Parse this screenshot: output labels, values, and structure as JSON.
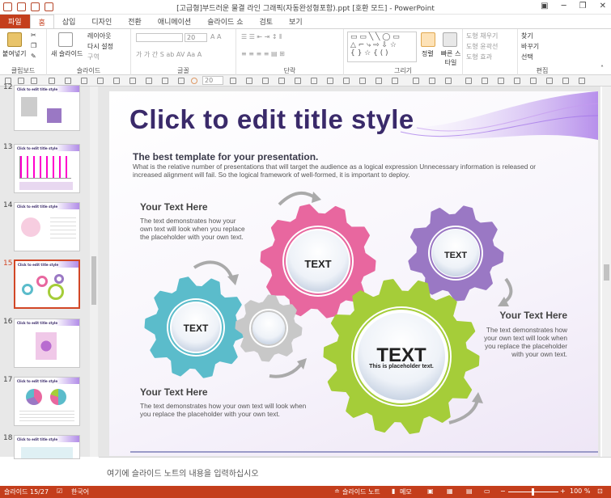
{
  "window": {
    "title": "[고급형]부드러운 물결 라인 그래픽(자동완성형포함).ppt [호환 모드] - PowerPoint"
  },
  "tabs": [
    "파일",
    "홈",
    "삽입",
    "디자인",
    "전환",
    "애니메이션",
    "슬라이드 쇼",
    "검토",
    "보기"
  ],
  "ribbon": {
    "paste": "붙여넣기",
    "clipboard": "클립보드",
    "new_slide": "새 슬라이드",
    "layout": "레이아웃",
    "reset": "다시 설정",
    "section": "구역",
    "slides": "슬라이드",
    "font_size": "20",
    "font": "글꼴",
    "paragraph": "단락",
    "arrange": "정렬",
    "quick_style": "빠른 스타일",
    "shape_fill": "도형 채우기",
    "shape_outline": "도형 윤곽선",
    "shape_effect": "도형 효과",
    "drawing": "그리기",
    "find": "찾기",
    "replace": "바꾸기",
    "select": "선택",
    "editing": "편집",
    "tb2_font_size": "20"
  },
  "thumbs": [
    {
      "num": "12",
      "title": "Click to edit title style"
    },
    {
      "num": "13",
      "title": "Click to edit title style"
    },
    {
      "num": "14",
      "title": "Click to edit title style"
    },
    {
      "num": "15",
      "title": "Click to edit title style"
    },
    {
      "num": "16",
      "title": "Click to edit title style"
    },
    {
      "num": "17",
      "title": "Click to edit title style"
    },
    {
      "num": "18",
      "title": "Click to edit title style"
    }
  ],
  "slide": {
    "title": "Click to edit title style",
    "subtitle": "The best template for your presentation.",
    "desc1": "What is the relative number of presentations that will target the audience as a logical expression Unnecessary information is released or",
    "desc2": "increased alignment will fail. So the logical framework of well-formed, it is important to deploy.",
    "b1_head": "Your Text Here",
    "b1_l1": "The text demonstrates how your",
    "b1_l2": "own text will look when you replace",
    "b1_l3": "the placeholder with your own text.",
    "b2_head": "Your Text Here",
    "b2_l1": "The text demonstrates how",
    "b2_l2": "your own text will look when",
    "b2_l3": "you replace the placeholder",
    "b2_l4": "with your own text.",
    "b3_head": "Your Text Here",
    "b3_l1": "The text demonstrates how your own text will look when",
    "b3_l2": "you replace the placeholder with your own text.",
    "gear_pink": "TEXT",
    "gear_purple": "TEXT",
    "gear_teal": "TEXT",
    "gear_green": "TEXT",
    "gear_green_sub": "This is placeholder text."
  },
  "notes_placeholder": "여기에 슬라이드 노트의 내용을 입력하십시오",
  "status": {
    "slide": "슬라이드 15/27",
    "lang": "한국어",
    "notes": "슬라이드 노트",
    "memo": "메모",
    "zoom": "100 %"
  },
  "colors": {
    "accent": "#c43e1c",
    "title": "#3a2a6a",
    "pink": "#e8679f",
    "purple": "#9a78c4",
    "teal": "#5bbccb",
    "green": "#a5cd39",
    "gray": "#c8c8c8"
  }
}
